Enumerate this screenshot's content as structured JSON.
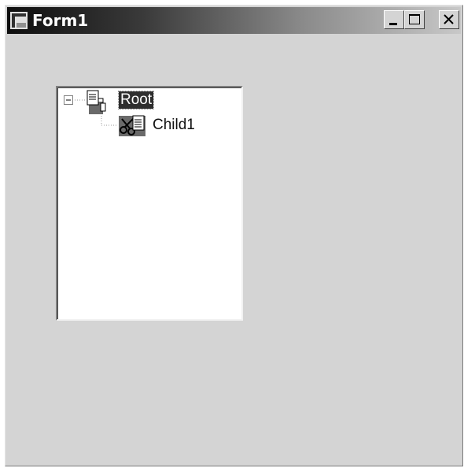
{
  "window": {
    "title": "Form1",
    "icon": "app-window-icon",
    "controls": [
      "minimize-icon",
      "maximize-icon",
      "close-icon"
    ]
  },
  "tree": {
    "root": {
      "label": "Root",
      "expanded": true,
      "selected": true,
      "icon": "document-icon",
      "children": [
        {
          "label": "Child1",
          "icon": "cut-paste-icon"
        }
      ]
    }
  }
}
